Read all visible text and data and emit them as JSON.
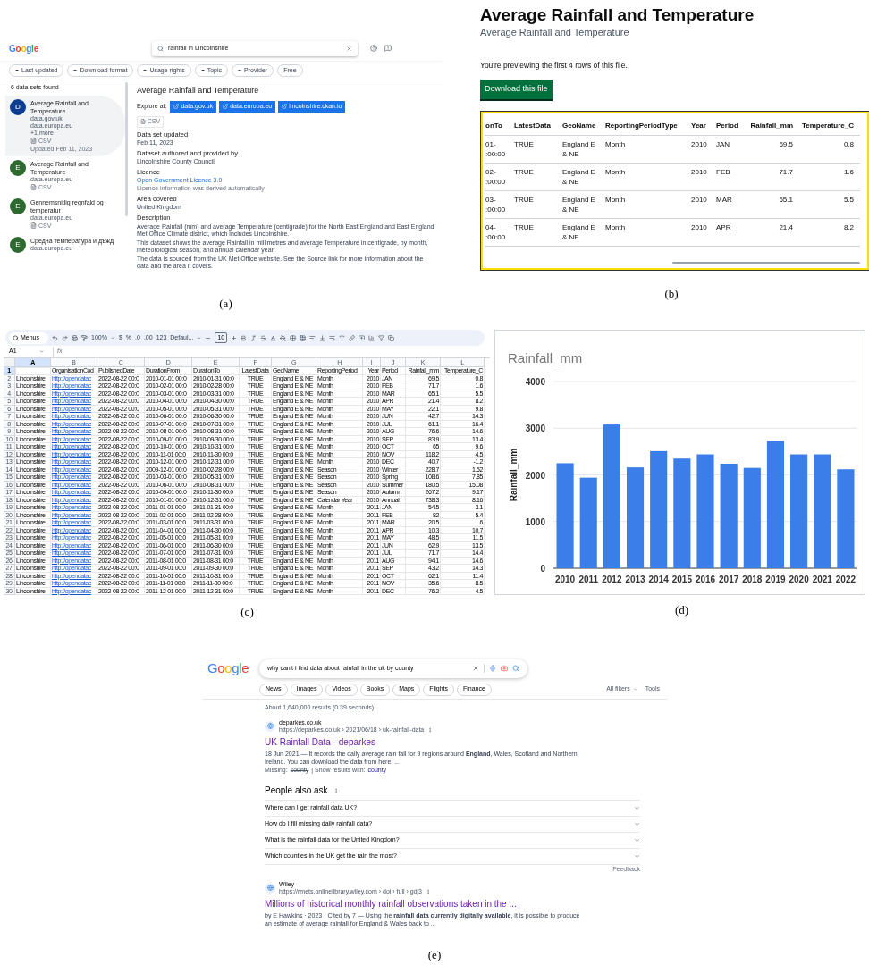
{
  "captions": [
    "(a)",
    "(b)",
    "(c)",
    "(d)",
    "(e)"
  ],
  "dataset_search": {
    "logo": "Google",
    "search": {
      "value": "rainfall in Lincolnshire"
    },
    "filters": [
      {
        "label": "Last updated",
        "kind": "dropdown"
      },
      {
        "label": "Download format",
        "kind": "dropdown"
      },
      {
        "label": "Usage rights",
        "kind": "dropdown"
      },
      {
        "label": "Topic",
        "kind": "dropdown"
      },
      {
        "label": "Provider",
        "kind": "dropdown"
      },
      {
        "label": "Free",
        "kind": "toggle"
      }
    ],
    "result_count": "6 data sets found",
    "results": [
      {
        "initial": "D",
        "color": "#0b3d91",
        "title": "Average Rainfall and Temperature",
        "sources": [
          "data.gov.uk",
          "data.europa.eu",
          "+1 more"
        ],
        "format": "CSV",
        "updated": "Updated Feb 11, 2023",
        "selected": true
      },
      {
        "initial": "E",
        "color": "#2d6a2f",
        "title": "Average Rainfall and Temperature",
        "sources": [
          "data.europa.eu"
        ],
        "format": "CSV",
        "selected": false
      },
      {
        "initial": "E",
        "color": "#2d6a2f",
        "title": "Gennemsnitlig regnfald og temperatur",
        "sources": [
          "data.europa.eu"
        ],
        "format": "CSV",
        "selected": false
      },
      {
        "initial": "E",
        "color": "#2d6a2f",
        "title": "Средна температура и дъжд",
        "sources": [
          "data.europa.eu"
        ],
        "selected": false
      }
    ],
    "detail": {
      "title": "Average Rainfall and Temperature",
      "explore_label": "Explore at:",
      "explore_links": [
        "data.gov.uk",
        "data.europa.eu",
        "lincolnshire.ckan.io"
      ],
      "format": "CSV",
      "sections": [
        {
          "heading": "Data set updated",
          "value": "Feb 11, 2023"
        },
        {
          "heading": "Dataset authored and provided by",
          "value": "Lincolnshire County Council"
        },
        {
          "heading": "Licence",
          "link": "Open Government Licence 3.0",
          "note": "Licence information was derived automatically"
        },
        {
          "heading": "Area covered",
          "value": "United Kingdom"
        },
        {
          "heading": "Description",
          "paragraphs": [
            "Average Rainfall (mm) and average Temperature (centigrade) for the North East England and East England Met Office Climate district, which includes Lincolnshire.",
            "This dataset shows the average Rainfall in millimetres and average Temperature in centigrade, by month, meteorological season, and annual calendar year.",
            "The data is sourced from the UK Met Office website. See the Source link for more information about the data and the area it covers."
          ]
        }
      ]
    }
  },
  "file_preview": {
    "title": "Average Rainfall and Temperature",
    "subtitle": "Average Rainfall and Temperature",
    "notice": "You're previewing the first 4 rows of this file.",
    "download_button": "Download this file",
    "columns": [
      "onTo",
      "LatestData",
      "GeoName",
      "ReportingPeriodType",
      "Year",
      "Period",
      "Rainfall_mm",
      "Temperature_C"
    ],
    "rows": [
      [
        "01- :00:00",
        "TRUE",
        "England E & NE",
        "Month",
        "2010",
        "JAN",
        "69.5",
        "0.8"
      ],
      [
        "02- :00:00",
        "TRUE",
        "England E & NE",
        "Month",
        "2010",
        "FEB",
        "71.7",
        "1.6"
      ],
      [
        "03- :00:00",
        "TRUE",
        "England E & NE",
        "Month",
        "2010",
        "MAR",
        "65.1",
        "5.5"
      ],
      [
        "04- :00:00",
        "TRUE",
        "England E & NE",
        "Month",
        "2010",
        "APR",
        "21.4",
        "8.2"
      ]
    ]
  },
  "spreadsheet": {
    "toolbar": {
      "menus": "Menus",
      "zoom": "100%",
      "currency": "$",
      "percent": "%",
      "decrease_decimals": ".0",
      "increase_decimals": ".00",
      "number_format": "123",
      "font": "Defaul...",
      "font_size": "10"
    },
    "name_box": "A1",
    "formula_label": "fx",
    "columns": [
      {
        "letter": "A",
        "selected": true
      },
      {
        "letter": "B",
        "selected": false
      },
      {
        "letter": "C",
        "selected": false
      },
      {
        "letter": "D",
        "selected": false
      },
      {
        "letter": "E",
        "selected": false
      },
      {
        "letter": "F",
        "selected": false
      },
      {
        "letter": "G",
        "selected": false
      },
      {
        "letter": "H",
        "selected": false
      },
      {
        "letter": "I",
        "selected": false
      },
      {
        "letter": "J",
        "selected": false
      },
      {
        "letter": "K",
        "selected": false
      },
      {
        "letter": "L",
        "selected": false
      }
    ],
    "rows": [
      {
        "number": "1",
        "selected": true,
        "cells": [
          "",
          "OrganisationCod",
          "PublishedDate",
          "DurationFrom",
          "DurationTo",
          "LatestData",
          "GeoName",
          "ReportingPeriod",
          "Year",
          "Period",
          "Rainfall_mm",
          "Temperature_C"
        ]
      },
      {
        "number": "2",
        "selected": false,
        "cells": [
          "Lincolnshire",
          "http://opendatac",
          "2022-08-22 00:0",
          "2010-01-01 00:0",
          "2010-01-31 00:0",
          "TRUE",
          "England E & NE",
          "Month",
          "2010",
          "JAN",
          "69.5",
          "0.8"
        ]
      },
      {
        "number": "3",
        "selected": false,
        "cells": [
          "Lincolnshire",
          "http://opendatac",
          "2022-08-22 00:0",
          "2010-02-01 00:0",
          "2010-02-28 00:0",
          "TRUE",
          "England E & NE",
          "Month",
          "2010",
          "FEB",
          "71.7",
          "1.6"
        ]
      },
      {
        "number": "4",
        "selected": false,
        "cells": [
          "Lincolnshire",
          "http://opendatac",
          "2022-08-22 00:0",
          "2010-03-01 00:0",
          "2010-03-31 00:0",
          "TRUE",
          "England E & NE",
          "Month",
          "2010",
          "MAR",
          "65.1",
          "5.5"
        ]
      },
      {
        "number": "5",
        "selected": false,
        "cells": [
          "Lincolnshire",
          "http://opendatac",
          "2022-08-22 00:0",
          "2010-04-01 00:0",
          "2010-04-30 00:0",
          "TRUE",
          "England E & NE",
          "Month",
          "2010",
          "APR",
          "21.4",
          "8.2"
        ]
      },
      {
        "number": "6",
        "selected": false,
        "cells": [
          "Lincolnshire",
          "http://opendatac",
          "2022-08-22 00:0",
          "2010-05-01 00:0",
          "2010-05-31 00:0",
          "TRUE",
          "England E & NE",
          "Month",
          "2010",
          "MAY",
          "22.1",
          "9.8"
        ]
      },
      {
        "number": "7",
        "selected": false,
        "cells": [
          "Lincolnshire",
          "http://opendatac",
          "2022-08-22 00:0",
          "2010-06-01 00:0",
          "2010-06-30 00:0",
          "TRUE",
          "England E & NE",
          "Month",
          "2010",
          "JUN",
          "42.7",
          "14.3"
        ]
      },
      {
        "number": "8",
        "selected": false,
        "cells": [
          "Lincolnshire",
          "http://opendatac",
          "2022-08-22 00:0",
          "2010-07-01 00:0",
          "2010-07-31 00:0",
          "TRUE",
          "England E & NE",
          "Month",
          "2010",
          "JUL",
          "61.1",
          "16.4"
        ]
      },
      {
        "number": "9",
        "selected": false,
        "cells": [
          "Lincolnshire",
          "http://opendatac",
          "2022-08-22 00:0",
          "2010-08-01 00:0",
          "2010-08-31 00:0",
          "TRUE",
          "England E & NE",
          "Month",
          "2010",
          "AUG",
          "76.6",
          "14.6"
        ]
      },
      {
        "number": "10",
        "selected": false,
        "cells": [
          "Lincolnshire",
          "http://opendatac",
          "2022-08-22 00:0",
          "2010-09-01 00:0",
          "2010-09-30 00:0",
          "TRUE",
          "England E & NE",
          "Month",
          "2010",
          "SEP",
          "83.9",
          "13.4"
        ]
      },
      {
        "number": "11",
        "selected": false,
        "cells": [
          "Lincolnshire",
          "http://opendatac",
          "2022-08-22 00:0",
          "2010-10-01 00:0",
          "2010-10-31 00:0",
          "TRUE",
          "England E & NE",
          "Month",
          "2010",
          "OCT",
          "65",
          "9.6"
        ]
      },
      {
        "number": "12",
        "selected": false,
        "cells": [
          "Lincolnshire",
          "http://opendatac",
          "2022-08-22 00:0",
          "2010-11-01 00:0",
          "2010-11-30 00:0",
          "TRUE",
          "England E & NE",
          "Month",
          "2010",
          "NOV",
          "118.2",
          "4.5"
        ]
      },
      {
        "number": "13",
        "selected": false,
        "cells": [
          "Lincolnshire",
          "http://opendatac",
          "2022-08-22 00:0",
          "2010-12-01 00:0",
          "2010-12-31 00:0",
          "TRUE",
          "England E & NE",
          "Month",
          "2010",
          "DEC",
          "40.7",
          "-1.2"
        ]
      },
      {
        "number": "14",
        "selected": false,
        "cells": [
          "Lincolnshire",
          "http://opendatac",
          "2022-08-22 00:0",
          "2009-12-01 00:0",
          "2010-02-28 00:0",
          "TRUE",
          "England E & NE",
          "Season",
          "2010",
          "Winter",
          "228.7",
          "1.52"
        ]
      },
      {
        "number": "15",
        "selected": false,
        "cells": [
          "Lincolnshire",
          "http://opendatac",
          "2022-08-22 00:0",
          "2010-03-01 00:0",
          "2010-05-31 00:0",
          "TRUE",
          "England E & NE",
          "Season",
          "2010",
          "Spring",
          "108.6",
          "7.85"
        ]
      },
      {
        "number": "16",
        "selected": false,
        "cells": [
          "Lincolnshire",
          "http://opendatac",
          "2022-08-22 00:0",
          "2010-06-01 00:0",
          "2010-08-31 00:0",
          "TRUE",
          "England E & NE",
          "Season",
          "2010",
          "Summer",
          "180.5",
          "15.08"
        ]
      },
      {
        "number": "17",
        "selected": false,
        "cells": [
          "Lincolnshire",
          "http://opendatac",
          "2022-08-22 00:0",
          "2010-09-01 00:0",
          "2010-11-30 00:0",
          "TRUE",
          "England E & NE",
          "Season",
          "2010",
          "Autumn",
          "267.2",
          "9.17"
        ]
      },
      {
        "number": "18",
        "selected": false,
        "cells": [
          "Lincolnshire",
          "http://opendatac",
          "2022-08-22 00:0",
          "2010-01-01 00:0",
          "2010-12-31 00:0",
          "TRUE",
          "England E & NE",
          "Calendar Year",
          "2010",
          "Annual",
          "738.3",
          "8.16"
        ]
      },
      {
        "number": "19",
        "selected": false,
        "cells": [
          "Lincolnshire",
          "http://opendatac",
          "2022-08-22 00:0",
          "2011-01-01 00:0",
          "2011-01-31 00:0",
          "TRUE",
          "England E & NE",
          "Month",
          "2011",
          "JAN",
          "54.5",
          "3.1"
        ]
      },
      {
        "number": "20",
        "selected": false,
        "cells": [
          "Lincolnshire",
          "http://opendatac",
          "2022-08-22 00:0",
          "2011-02-01 00:0",
          "2011-02-28 00:0",
          "TRUE",
          "England E & NE",
          "Month",
          "2011",
          "FEB",
          "82",
          "5.4"
        ]
      },
      {
        "number": "21",
        "selected": false,
        "cells": [
          "Lincolnshire",
          "http://opendatac",
          "2022-08-22 00:0",
          "2011-03-01 00:0",
          "2011-03-31 00:0",
          "TRUE",
          "England E & NE",
          "Month",
          "2011",
          "MAR",
          "20.5",
          "6"
        ]
      },
      {
        "number": "22",
        "selected": false,
        "cells": [
          "Lincolnshire",
          "http://opendatac",
          "2022-08-22 00:0",
          "2011-04-01 00:0",
          "2011-04-30 00:0",
          "TRUE",
          "England E & NE",
          "Month",
          "2011",
          "APR",
          "10.3",
          "10.7"
        ]
      },
      {
        "number": "23",
        "selected": false,
        "cells": [
          "Lincolnshire",
          "http://opendatac",
          "2022-08-22 00:0",
          "2011-05-01 00:0",
          "2011-05-31 00:0",
          "TRUE",
          "England E & NE",
          "Month",
          "2011",
          "MAY",
          "48.5",
          "11.5"
        ]
      },
      {
        "number": "24",
        "selected": false,
        "cells": [
          "Lincolnshire",
          "http://opendatac",
          "2022-08-22 00:0",
          "2011-06-01 00:0",
          "2011-06-30 00:0",
          "TRUE",
          "England E & NE",
          "Month",
          "2011",
          "JUN",
          "62.9",
          "13.5"
        ]
      },
      {
        "number": "25",
        "selected": false,
        "cells": [
          "Lincolnshire",
          "http://opendatac",
          "2022-08-22 00:0",
          "2011-07-01 00:0",
          "2011-07-31 00:0",
          "TRUE",
          "England E & NE",
          "Month",
          "2011",
          "JUL",
          "71.7",
          "14.4"
        ]
      },
      {
        "number": "26",
        "selected": false,
        "cells": [
          "Lincolnshire",
          "http://opendatac",
          "2022-08-22 00:0",
          "2011-08-01 00:0",
          "2011-08-31 00:0",
          "TRUE",
          "England E & NE",
          "Month",
          "2011",
          "AUG",
          "94.1",
          "14.6"
        ]
      },
      {
        "number": "27",
        "selected": false,
        "cells": [
          "Lincolnshire",
          "http://opendatac",
          "2022-08-22 00:0",
          "2011-09-01 00:0",
          "2011-09-30 00:0",
          "TRUE",
          "England E & NE",
          "Month",
          "2011",
          "SEP",
          "43.2",
          "14.3"
        ]
      },
      {
        "number": "28",
        "selected": false,
        "cells": [
          "Lincolnshire",
          "http://opendatac",
          "2022-08-22 00:0",
          "2011-10-01 00:0",
          "2011-10-31 00:0",
          "TRUE",
          "England E & NE",
          "Month",
          "2011",
          "OCT",
          "62.1",
          "11.4"
        ]
      },
      {
        "number": "29",
        "selected": false,
        "cells": [
          "Lincolnshire",
          "http://opendatac",
          "2022-08-22 00:0",
          "2011-11-01 00:0",
          "2011-11-30 00:0",
          "TRUE",
          "England E & NE",
          "Month",
          "2011",
          "NOV",
          "35.6",
          "8.5"
        ]
      },
      {
        "number": "30",
        "selected": false,
        "cells": [
          "Lincolnshire",
          "http://opendatac",
          "2022-08-22 00:0",
          "2011-12-01 00:0",
          "2011-12-31 00:0",
          "TRUE",
          "England E & NE",
          "Month",
          "2011",
          "DEC",
          "76.2",
          "4.5"
        ]
      }
    ]
  },
  "rainfall_chart": {
    "chart_data": {
      "type": "bar",
      "title": "Rainfall_mm",
      "ylabel": "Rainfall_mm",
      "categories": [
        "2010",
        "2011",
        "2012",
        "2013",
        "2014",
        "2015",
        "2016",
        "2017",
        "2018",
        "2019",
        "2020",
        "2021",
        "2022"
      ],
      "series": [
        {
          "color": "#3b7de9",
          "values": [
            2250,
            1940,
            3080,
            2160,
            2510,
            2350,
            2440,
            2240,
            2150,
            2730,
            2440,
            2440,
            2120
          ]
        }
      ],
      "ylim": [
        0,
        4000
      ],
      "yticks": [
        0,
        1000,
        2000,
        3000,
        4000
      ],
      "grid": true
    }
  },
  "web_search": {
    "logo": "Google",
    "search": {
      "value": "why can't i find data about rainfall in the uk by county"
    },
    "tabs": [
      "News",
      "Images",
      "Videos",
      "Books",
      "Maps",
      "Flights",
      "Finance"
    ],
    "all_filters": "All filters",
    "tools": "Tools",
    "stats": "About 1,640,000 results (0.39 seconds)",
    "results": [
      {
        "site": "deparkes.co.uk",
        "url": "https://deparkes.co.uk › 2021/06/18 › uk-rainfall-data",
        "title": "UK Rainfall Data - deparkes",
        "snippet": "18 Jun 2021 — It records the daily average rain fall for 9 regions around **England**, Wales, Scotland and Northern Ireland. You can download the data from here: ...",
        "missing_label": "Missing:",
        "missing_term": "county",
        "show_label": "| Show results with:",
        "show_link": "county"
      }
    ],
    "people_also_ask": {
      "heading": "People also ask",
      "questions": [
        {
          "text": "Where can I get rainfall data UK?",
          "expanded": false
        },
        {
          "text": "How do I fill missing daily rainfall data?",
          "expanded": false
        },
        {
          "text": "What is the rainfall data for the United Kingdom?",
          "expanded": false
        },
        {
          "text": "Which counties in the UK get the rain the most?",
          "expanded": false
        }
      ],
      "feedback": "Feedback"
    },
    "results_after": [
      {
        "site": "Wiley",
        "url": "https://rmets.onlinelibrary.wiley.com › doi › full › gdj3",
        "title": "Millions of historical monthly rainfall observations taken in the ...",
        "snippet": "by E Hawkins · 2023 · Cited by 7 — Using the **rainfall data currently digitally available**, it is possible to produce an estimate of average rainfall for England & Wales back to ..."
      }
    ]
  }
}
